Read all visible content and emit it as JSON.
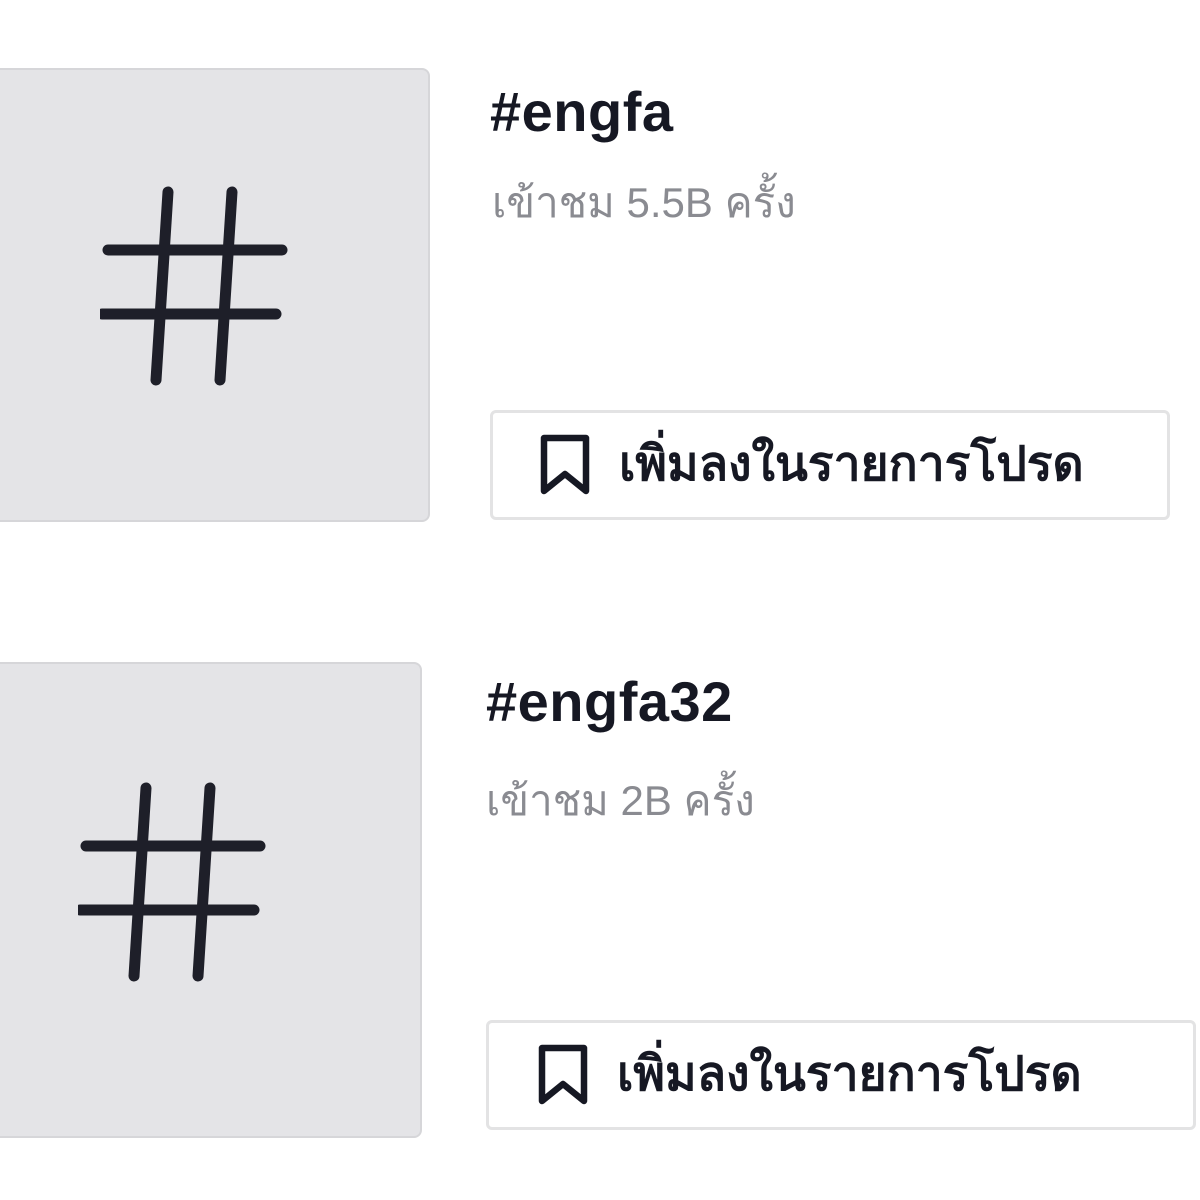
{
  "hashtags": [
    {
      "title": "#engfa",
      "views": "เข้าชม 5.5B ครั้ง",
      "favorite_label": "เพิ่มลงในรายการโปรด",
      "thumbnail_icon": "hashtag-icon",
      "button_icon": "bookmark-icon"
    },
    {
      "title": "#engfa32",
      "views": "เข้าชม 2B ครั้ง",
      "favorite_label": "เพิ่มลงในรายการโปรด",
      "thumbnail_icon": "hashtag-icon",
      "button_icon": "bookmark-icon"
    }
  ],
  "colors": {
    "text_primary": "#161823",
    "text_secondary": "#8a8b91",
    "thumbnail_bg": "#e4e4e7",
    "border": "#e3e3e4"
  }
}
